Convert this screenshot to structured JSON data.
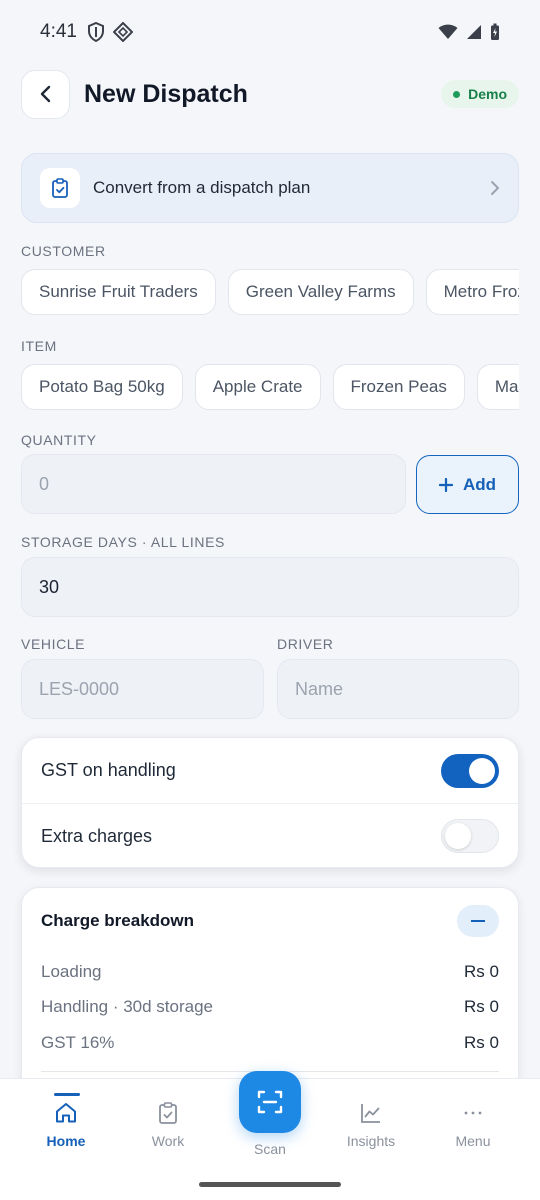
{
  "status_bar": {
    "time": "4:41"
  },
  "header": {
    "title": "New Dispatch",
    "badge": "Demo"
  },
  "plan_card": {
    "label": "Convert from a dispatch plan"
  },
  "customer": {
    "label": "CUSTOMER",
    "options": [
      "Sunrise Fruit Traders",
      "Green Valley Farms",
      "Metro Frozen"
    ]
  },
  "item": {
    "label": "ITEM",
    "options": [
      "Potato Bag 50kg",
      "Apple Crate",
      "Frozen Peas",
      "Mango Box"
    ]
  },
  "quantity": {
    "label": "QUANTITY",
    "placeholder": "0",
    "add_label": "Add"
  },
  "storage": {
    "label": "STORAGE DAYS · ALL LINES",
    "value": "30"
  },
  "vehicle": {
    "label": "VEHICLE",
    "placeholder": "LES-0000"
  },
  "driver": {
    "label": "DRIVER",
    "placeholder": "Name"
  },
  "toggles": {
    "gst": {
      "label": "GST on handling",
      "on": true
    },
    "extra": {
      "label": "Extra charges",
      "on": false
    }
  },
  "breakdown": {
    "title": "Charge breakdown",
    "rows": [
      {
        "label": "Loading",
        "amount": "Rs 0"
      },
      {
        "label": "Handling · 30d storage",
        "amount": "Rs 0"
      },
      {
        "label": "GST 16%",
        "amount": "Rs 0"
      }
    ]
  },
  "nav": {
    "home": "Home",
    "work": "Work",
    "scan": "Scan",
    "insights": "Insights",
    "menu": "Menu"
  },
  "colors": {
    "accent": "#1560b8",
    "fab": "#1e88e5",
    "demo_green": "#17804a"
  }
}
